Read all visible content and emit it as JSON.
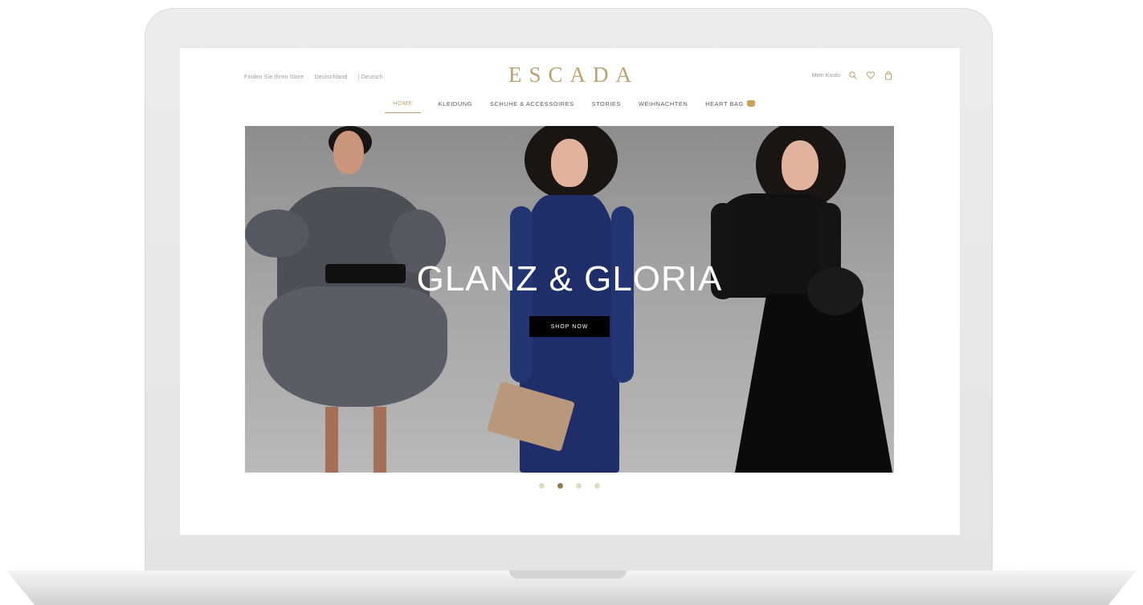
{
  "header": {
    "store_finder": "Finden Sie Ihren Store",
    "country": "Deutschland",
    "language": "| Deutsch",
    "logo": "ESCADA",
    "account": "Mein Konto"
  },
  "nav": {
    "items": [
      "HOME",
      "KLEIDUNG",
      "SCHUHE & ACCESSOIRES",
      "STORIES",
      "WEIHNACHTEN",
      "HEART BAG"
    ],
    "active_index": 0
  },
  "hero": {
    "headline": "GLANZ & GLORIA",
    "cta": "SHOP NOW"
  },
  "carousel": {
    "count": 4,
    "active_index": 1
  },
  "colors": {
    "brand_gold": "#b9a173",
    "cta_background": "#000000",
    "hero_background": "#a4a4a4"
  },
  "icons": [
    "search-icon",
    "heart-icon",
    "shopping-bag-icon",
    "heart-bag-icon"
  ]
}
